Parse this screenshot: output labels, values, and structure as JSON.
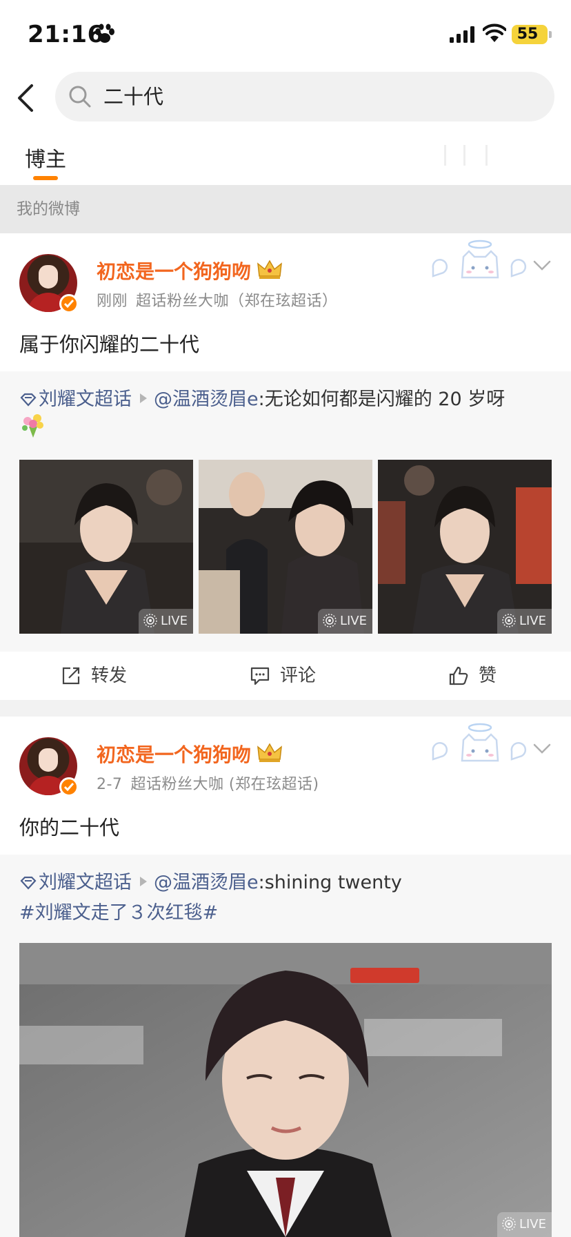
{
  "status_bar": {
    "time": "21:16",
    "battery": "55",
    "icons": [
      "paw-icon",
      "signal-icon",
      "wifi-icon",
      "battery-icon"
    ]
  },
  "search": {
    "query": "二十代",
    "icons": [
      "back-arrow-icon",
      "search-icon"
    ]
  },
  "tabs": [
    {
      "label": "博主",
      "active": true
    }
  ],
  "section": {
    "title": "我的微博"
  },
  "colors": {
    "accent": "#ff8200",
    "username": "#f2661f",
    "link": "#4b5f8d",
    "meta": "#8b8b8b",
    "section_bg": "#e8e8e8",
    "repost_bg": "#f7f7f7"
  },
  "posts": [
    {
      "username": "初恋是一个狗狗吻",
      "time": "刚刚",
      "badge_text": "超话粉丝大咖（郑在玹超话）",
      "text": "属于你闪耀的二十代",
      "repost": {
        "topic": "刘耀文超话",
        "author": "@温酒烫眉e",
        "body": ":无论如何都是闪耀的 20 岁呀",
        "hashtag": "",
        "images": [
          {
            "badge": "LIVE"
          },
          {
            "badge": "LIVE"
          },
          {
            "badge": "LIVE"
          }
        ]
      },
      "actions": {
        "repost": "转发",
        "comment": "评论",
        "like": "赞"
      }
    },
    {
      "username": "初恋是一个狗狗吻",
      "time": "2-7",
      "badge_text": "超话粉丝大咖 (郑在玹超话)",
      "text": "你的二十代",
      "repost": {
        "topic": "刘耀文超话",
        "author": "@温酒烫眉e",
        "body": ":shining twenty",
        "hashtag": "#刘耀文走了３次红毯#",
        "images": [
          {
            "badge": "LIVE"
          }
        ]
      }
    }
  ]
}
